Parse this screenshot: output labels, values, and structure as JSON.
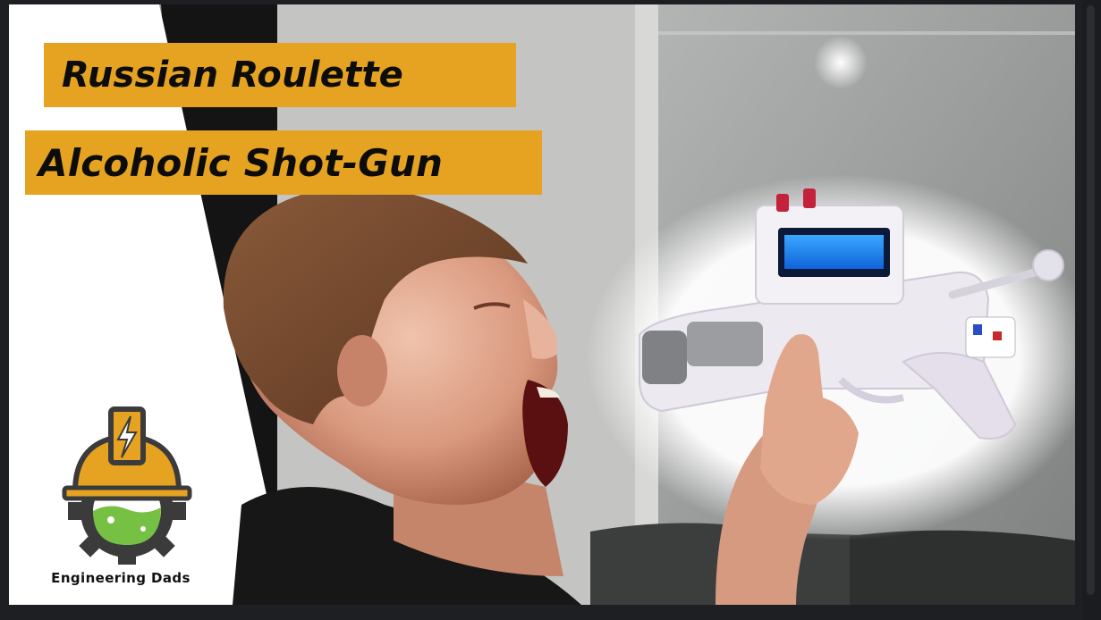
{
  "thumbnail": {
    "title_line_1": "Russian Roulette",
    "title_line_2": "Alcoholic Shot-Gun",
    "channel_name": "Engineering Dads"
  },
  "colors": {
    "accent_yellow": "#e6a321",
    "logo_gray": "#3b3b3b",
    "logo_green": "#76c043",
    "frame_dark": "#1e1f22"
  },
  "icons": {
    "logo": "engineering-dads-logo-icon",
    "lightning": "lightning-bolt-icon",
    "gear": "gear-icon",
    "hard_hat": "hard-hat-icon"
  }
}
